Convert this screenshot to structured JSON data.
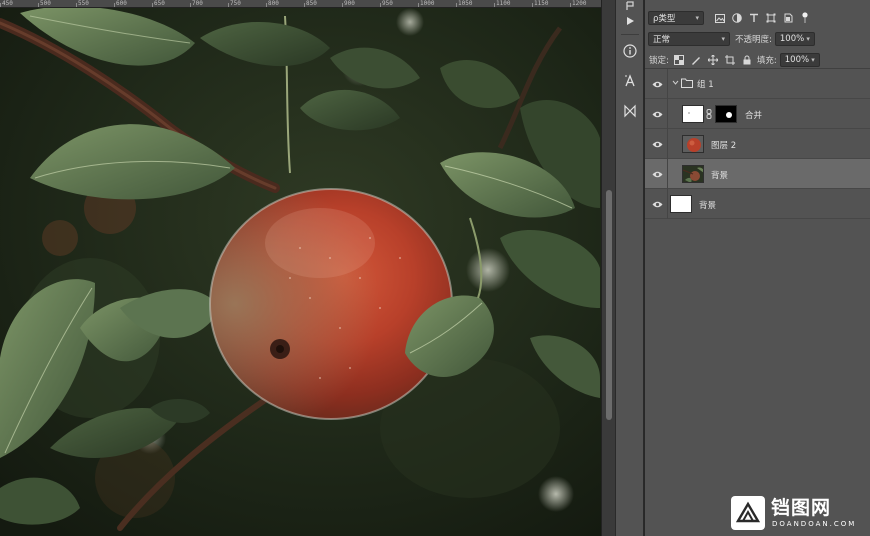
{
  "ruler": {
    "labels": [
      "450",
      "500",
      "550",
      "600",
      "650",
      "700",
      "750",
      "800",
      "850",
      "900",
      "950",
      "1000",
      "1050",
      "1100",
      "1150",
      "1200"
    ]
  },
  "layers_panel": {
    "filter": {
      "kind_label": "ρ类型",
      "icons": [
        "image-filter-icon",
        "adjustment-filter-icon",
        "type-filter-icon",
        "shape-filter-icon",
        "smart-object-filter-icon",
        "filter-toggle-icon"
      ]
    },
    "blend": {
      "mode": "正常",
      "opacity_label": "不透明度:",
      "opacity_value": "100%"
    },
    "lock": {
      "label": "锁定:",
      "fill_label": "填充:",
      "fill_value": "100%"
    },
    "layers": [
      {
        "name": "组 1",
        "type": "group",
        "selected": false
      },
      {
        "name": "合并",
        "type": "masked",
        "selected": false
      },
      {
        "name": "图层 2",
        "type": "apple",
        "selected": false
      },
      {
        "name": "背景",
        "type": "photo",
        "selected": true
      },
      {
        "name": "背景",
        "type": "white",
        "selected": false
      }
    ]
  },
  "colors": {
    "panel_bg": "#535353",
    "selected_layer": "#6a6a6a",
    "canvas_bg": "#1c1c1c",
    "apple_red": "#b8402a"
  },
  "watermark": {
    "title": "铛图网",
    "subtitle": "DOANDOAN.COM"
  }
}
